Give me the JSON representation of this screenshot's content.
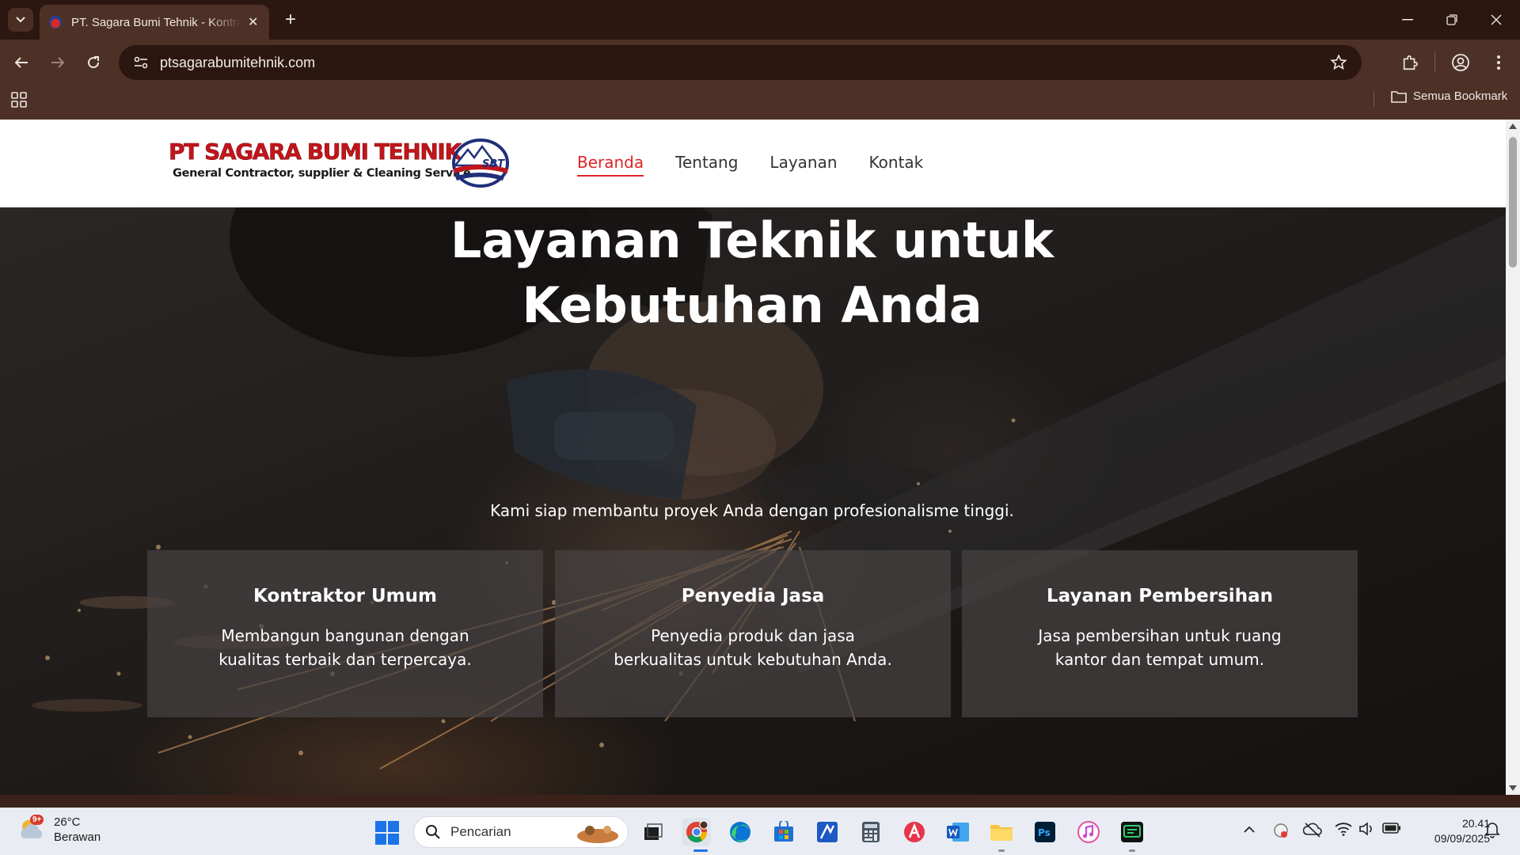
{
  "browser": {
    "tab_title": "PT. Sagara Bumi Tehnik - Kontraktor",
    "url": "ptsagarabumitehnik.com",
    "bookmarks_all_label": "Semua Bookmark"
  },
  "site": {
    "logo_line1": "PT SAGARA BUMI TEHNIK",
    "logo_line2": "General Contractor, supplier & Cleaning Service",
    "logo_emblem_text": "SBT",
    "nav": [
      {
        "label": "Beranda",
        "active": true
      },
      {
        "label": "Tentang",
        "active": false
      },
      {
        "label": "Layanan",
        "active": false
      },
      {
        "label": "Kontak",
        "active": false
      }
    ],
    "accent_color": "#e02424"
  },
  "hero": {
    "title_line1": "Layanan Teknik untuk",
    "title_line2": "Kebutuhan Anda",
    "subtitle": "Kami siap membantu proyek Anda dengan profesionalisme tinggi."
  },
  "services": [
    {
      "title": "Kontraktor Umum",
      "desc": "Membangun bangunan dengan kualitas terbaik dan terpercaya."
    },
    {
      "title": "Penyedia Jasa",
      "desc": "Penyedia produk dan jasa berkualitas untuk kebutuhan Anda."
    },
    {
      "title": "Layanan Pembersihan",
      "desc": "Jasa pembersihan untuk ruang kantor dan tempat umum."
    }
  ],
  "taskbar": {
    "weather_badge": "9+",
    "weather_temp": "26°C",
    "weather_desc": "Berawan",
    "search_placeholder": "Pencarian",
    "time": "20.41",
    "date": "09/09/2025"
  }
}
